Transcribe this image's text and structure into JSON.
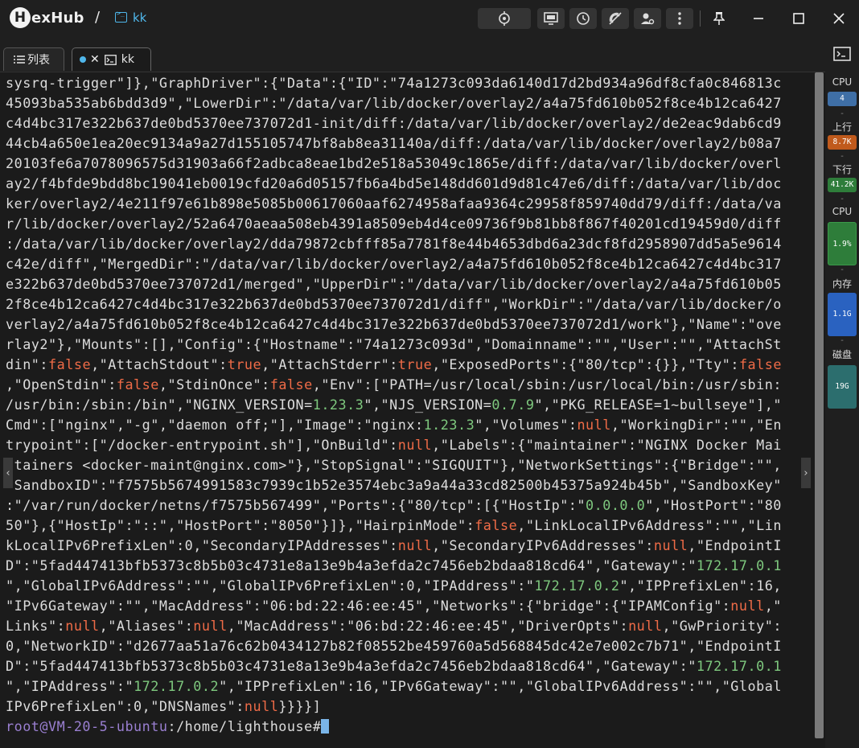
{
  "app": {
    "logo_letter": "H",
    "logo_rest": "exHub",
    "crumb_sep": "/",
    "crumb_label": "kk"
  },
  "tabs": [
    {
      "label": "列表",
      "icon": "list-icon"
    },
    {
      "label": "kk",
      "icon": "terminal-icon",
      "active": true
    }
  ],
  "sidebar": {
    "cpu_label": "CPU",
    "cpu_cores": "4",
    "up_label": "上行",
    "up_value": "8.7K",
    "down_label": "下行",
    "down_value": "41.2K",
    "cpu2_label": "CPU",
    "cpu_usage": "1.9%",
    "mem_label": "内存",
    "mem_value": "1.1G",
    "disk_label": "磁盘",
    "disk_value": "19G",
    "dash": "-"
  },
  "terminal": {
    "lines": [
      "sysrq-trigger\"]},\"GraphDriver\":{\"Data\":{\"ID\":\"74a1273c093da6140d17d2bd934a96df8cfa0c846813c",
      "45093ba535ab6bdd3d9\",\"LowerDir\":\"/data/var/lib/docker/overlay2/a4a75fd610b052f8ce4b12ca6427",
      "c4d4bc317e322b637de0bd5370ee737072d1-init/diff:/data/var/lib/docker/overlay2/de2eac9dab6cd9",
      "44cb4a650e1ea20ec9134a9a27d155105747bf8ab8ea31140a/diff:/data/var/lib/docker/overlay2/b08a7",
      "20103fe6a7078096575d31903a66f2adbca8eae1bd2e518a53049c1865e/diff:/data/var/lib/docker/overl",
      "ay2/f4bfde9bdd8bc19041eb0019cfd20a6d05157fb6a4bd5e148dd601d9d81c47e6/diff:/data/var/lib/doc",
      "ker/overlay2/4e211f97e61b898e5085b00617060aaf6274958afaa9364c29958f859740dd79/diff:/data/va",
      "r/lib/docker/overlay2/52a6470aeaa508eb4391a8509eb4d4ce09736f9b81bb8f867f40201cd19459d0/diff",
      ":/data/var/lib/docker/overlay2/dda79872cbfff85a7781f8e44b4653dbd6a23dcf8fd2958907dd5a5e9614",
      "c42e/diff\",\"MergedDir\":\"/data/var/lib/docker/overlay2/a4a75fd610b052f8ce4b12ca6427c4d4bc317",
      "e322b637de0bd5370ee737072d1/merged\",\"UpperDir\":\"/data/var/lib/docker/overlay2/a4a75fd610b05",
      "2f8ce4b12ca6427c4d4bc317e322b637de0bd5370ee737072d1/diff\",\"WorkDir\":\"/data/var/lib/docker/o",
      "verlay2/a4a75fd610b052f8ce4b12ca6427c4d4bc317e322b637de0bd5370ee737072d1/work\"},\"Name\":\"ove",
      "rlay2\"},\"Mounts\":[],\"Config\":{\"Hostname\":\"74a1273c093d\",\"Domainname\":\"\",\"User\":\"\",\"AttachSt",
      "din\":false,\"AttachStdout\":true,\"AttachStderr\":true,\"ExposedPorts\":{\"80/tcp\":{}},\"Tty\":false",
      ",\"OpenStdin\":false,\"StdinOnce\":false,\"Env\":[\"PATH=/usr/local/sbin:/usr/local/bin:/usr/sbin:",
      "/usr/bin:/sbin:/bin\",\"NGINX_VERSION=1.23.3\",\"NJS_VERSION=0.7.9\",\"PKG_RELEASE=1~bullseye\"],\"",
      "Cmd\":[\"nginx\",\"-g\",\"daemon off;\"],\"Image\":\"nginx:1.23.3\",\"Volumes\":null,\"WorkingDir\":\"\",\"En",
      "trypoint\":[\"/docker-entrypoint.sh\"],\"OnBuild\":null,\"Labels\":{\"maintainer\":\"NGINX Docker Mai",
      "ntainers <docker-maint@nginx.com>\"},\"StopSignal\":\"SIGQUIT\"},\"NetworkSettings\":{\"Bridge\":\"\",",
      "\"SandboxID\":\"f7575b5674991583c7939c1b52e3574ebc3a9a44a33cd82500b45375a924b45b\",\"SandboxKey\"",
      ":\"/var/run/docker/netns/f7575b567499\",\"Ports\":{\"80/tcp\":[{\"HostIp\":\"0.0.0.0\",\"HostPort\":\"80",
      "50\"},{\"HostIp\":\"::\",\"HostPort\":\"8050\"}]},\"HairpinMode\":false,\"LinkLocalIPv6Address\":\"\",\"Lin",
      "kLocalIPv6PrefixLen\":0,\"SecondaryIPAddresses\":null,\"SecondaryIPv6Addresses\":null,\"EndpointI",
      "D\":\"5fad447413bfb5373c8b5b03c4731e8a13e9b4a3efda2c7456eb2bdaa818cd64\",\"Gateway\":\"172.17.0.1",
      "\",\"GlobalIPv6Address\":\"\",\"GlobalIPv6PrefixLen\":0,\"IPAddress\":\"172.17.0.2\",\"IPPrefixLen\":16,",
      "\"IPv6Gateway\":\"\",\"MacAddress\":\"06:bd:22:46:ee:45\",\"Networks\":{\"bridge\":{\"IPAMConfig\":null,\"",
      "Links\":null,\"Aliases\":null,\"MacAddress\":\"06:bd:22:46:ee:45\",\"DriverOpts\":null,\"GwPriority\":",
      "0,\"NetworkID\":\"d2677aa51a76c62b0434127b82f08552be459760a5d568845dc42e7e002c7b71\",\"EndpointI",
      "D\":\"5fad447413bfb5373c8b5b03c4731e8a13e9b4a3efda2c7456eb2bdaa818cd64\",\"Gateway\":\"172.17.0.1",
      "\",\"IPAddress\":\"172.17.0.2\",\"IPPrefixLen\":16,\"IPv6Gateway\":\"\",\"GlobalIPv6Address\":\"\",\"Global",
      "IPv6PrefixLen\":0,\"DNSNames\":null}}}}]"
    ],
    "prompt_user": "root@VM-20-5-ubuntu",
    "prompt_path": ":/home/lighthouse#"
  },
  "colors": {
    "accent": "#4fb6ea",
    "key": "#ef6b47",
    "green": "#7ec87e",
    "purple": "#a389d4",
    "orange_badge": "#c05a1c",
    "green_badge": "#2e7d3a",
    "blue_badge": "#2a62c0",
    "teal_badge": "#2c6e6e"
  }
}
